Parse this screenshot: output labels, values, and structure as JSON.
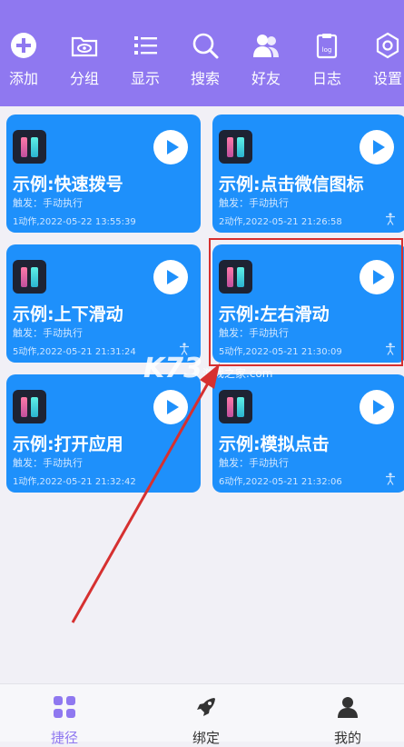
{
  "toolbar": {
    "items": [
      {
        "label": "添加"
      },
      {
        "label": "分组"
      },
      {
        "label": "显示"
      },
      {
        "label": "搜索"
      },
      {
        "label": "好友"
      },
      {
        "label": "日志"
      },
      {
        "label": "设置"
      }
    ]
  },
  "cards": [
    {
      "title": "示例:快速拨号",
      "trigger": "触发：手动执行",
      "meta": "1动作,2022-05-22 13:55:39",
      "person_icon": false
    },
    {
      "title": "示例:点击微信图标",
      "trigger": "触发：手动执行",
      "meta": "2动作,2022-05-21 21:26:58",
      "person_icon": true
    },
    {
      "title": "示例:上下滑动",
      "trigger": "触发：手动执行",
      "meta": "5动作,2022-05-21 21:31:24",
      "person_icon": true
    },
    {
      "title": "示例:左右滑动",
      "trigger": "触发：手动执行",
      "meta": "5动作,2022-05-21 21:30:09",
      "person_icon": true
    },
    {
      "title": "示例:打开应用",
      "trigger": "触发：手动执行",
      "meta": "1动作,2022-05-21 21:32:42",
      "person_icon": false
    },
    {
      "title": "示例:模拟点击",
      "trigger": "触发：手动执行",
      "meta": "6动作,2022-05-21 21:32:06",
      "person_icon": true
    }
  ],
  "watermark": {
    "brand": "K73",
    "sub": "游戏之家",
    "domain": ".com"
  },
  "bottom_nav": {
    "items": [
      {
        "label": "捷径",
        "active": true
      },
      {
        "label": "绑定",
        "active": false
      },
      {
        "label": "我的",
        "active": false
      }
    ]
  },
  "colors": {
    "header": "#8f78f0",
    "card": "#1e90fb",
    "active_nav": "#8f78f0",
    "inactive_nav": "#333333",
    "highlight": "#d63030"
  }
}
